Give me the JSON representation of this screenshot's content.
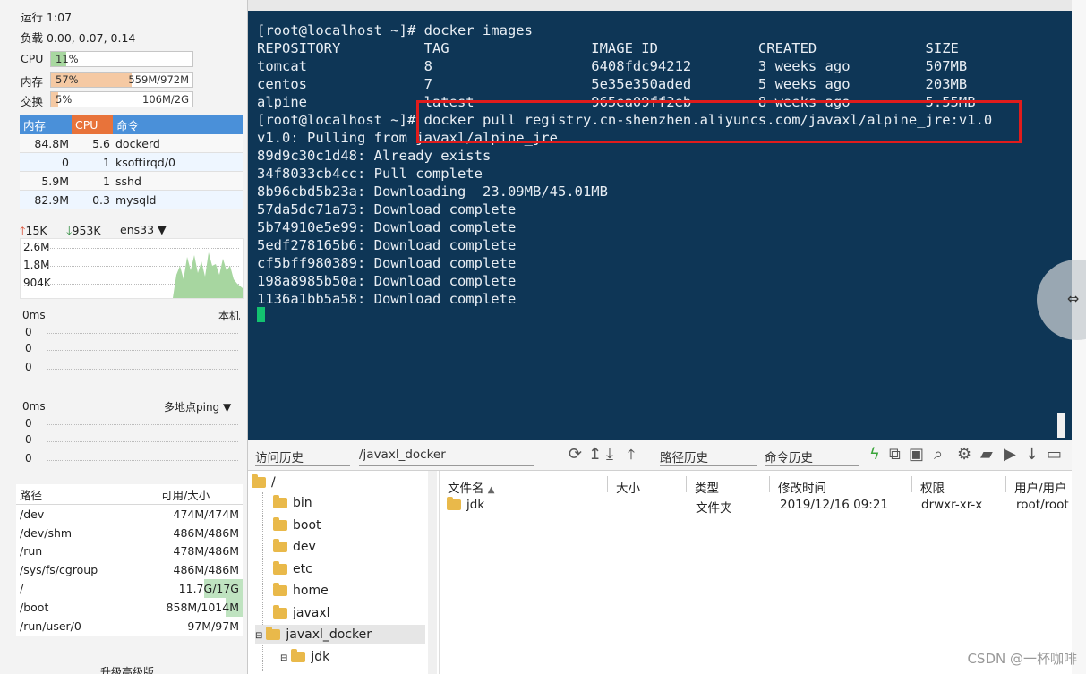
{
  "sysinfo": {
    "uptime": "运行 1:07",
    "load": "负载 0.00, 0.07, 0.14",
    "cpu": {
      "label": "CPU",
      "pct": "11%",
      "fraction": 0.11
    },
    "mem": {
      "label": "内存",
      "pct": "57%",
      "abs": "559M/972M",
      "fraction": 0.57
    },
    "swap": {
      "label": "交换",
      "pct": "5%",
      "abs": "106M/2G",
      "fraction": 0.05
    }
  },
  "processes": {
    "headers": [
      "内存",
      "CPU",
      "命令"
    ],
    "rows": [
      {
        "mem": "84.8M",
        "cpu": "5.6",
        "cmd": "dockerd"
      },
      {
        "mem": "0",
        "cpu": "1",
        "cmd": "ksoftirqd/0"
      },
      {
        "mem": "5.9M",
        "cpu": "1",
        "cmd": "sshd"
      },
      {
        "mem": "82.9M",
        "cpu": "0.3",
        "cmd": "mysqld"
      }
    ]
  },
  "network": {
    "up": "15K",
    "down": "953K",
    "iface": "ens33",
    "scale": [
      "2.6M",
      "1.8M",
      "904K"
    ]
  },
  "latency1": {
    "top": "0ms",
    "target": "本机",
    "values": [
      "0",
      "0",
      "0"
    ]
  },
  "latency2": {
    "top": "0ms",
    "target": "多地点ping",
    "values": [
      "0",
      "0",
      "0"
    ]
  },
  "disks": {
    "headers": [
      "路径",
      "可用/大小"
    ],
    "rows": [
      {
        "path": "/dev",
        "size": "474M/474M"
      },
      {
        "path": "/dev/shm",
        "size": "486M/486M"
      },
      {
        "path": "/run",
        "size": "478M/486M"
      },
      {
        "path": "/sys/fs/cgroup",
        "size": "486M/486M"
      },
      {
        "path": "/",
        "size": "11.7G/17G"
      },
      {
        "path": "/boot",
        "size": "858M/1014M"
      },
      {
        "path": "/run/user/0",
        "size": "97M/97M"
      }
    ],
    "footer": "升级高级版"
  },
  "terminal": {
    "lines": [
      "[root@localhost ~]# docker images",
      "REPOSITORY          TAG                 IMAGE ID            CREATED             SIZE",
      "tomcat              8                   6408fdc94212        3 weeks ago         507MB",
      "centos              7                   5e35e350aded        5 weeks ago         203MB",
      "alpine              latest              965ea09ff2eb        8 weeks ago         5.55MB",
      "[root@localhost ~]# docker pull registry.cn-shenzhen.aliyuncs.com/javaxl/alpine_jre:v1.0",
      "v1.0: Pulling from javaxl/alpine_jre",
      "89d9c30c1d48: Already exists",
      "34f8033cb4cc: Pull complete",
      "8b96cbd5b23a: Downloading  23.09MB/45.01MB",
      "57da5dc71a73: Download complete",
      "5b74910e5e99: Download complete",
      "5edf278165b6: Download complete",
      "cf5bff980389: Download complete",
      "198a8985b50a: Download complete",
      "1136a1bb5a58: Download complete"
    ]
  },
  "toolbar": {
    "history": "访问历史",
    "path": "/javaxl_docker",
    "path_history": "路径历史",
    "cmd_history": "命令历史"
  },
  "tree": {
    "root": "/",
    "items": [
      "bin",
      "boot",
      "dev",
      "etc",
      "home",
      "javaxl",
      "javaxl_docker",
      "jdk"
    ]
  },
  "files": {
    "headers": [
      "文件名",
      "大小",
      "类型",
      "修改时间",
      "权限",
      "用户/用户"
    ],
    "rows": [
      {
        "name": "jdk",
        "size": "",
        "type": "文件夹",
        "mtime": "2019/12/16 09:21",
        "perm": "drwxr-xr-x",
        "owner": "root/root"
      }
    ]
  },
  "watermark": "CSDN @一杯咖啡",
  "colors": {
    "terminal_bg": "#0e3656",
    "highlight": "#e01c1c",
    "header_blue": "#4a90d9",
    "cpu_orange": "#e8733a",
    "meter_green": "#a8d8a0",
    "meter_orange": "#f5c9a3"
  }
}
